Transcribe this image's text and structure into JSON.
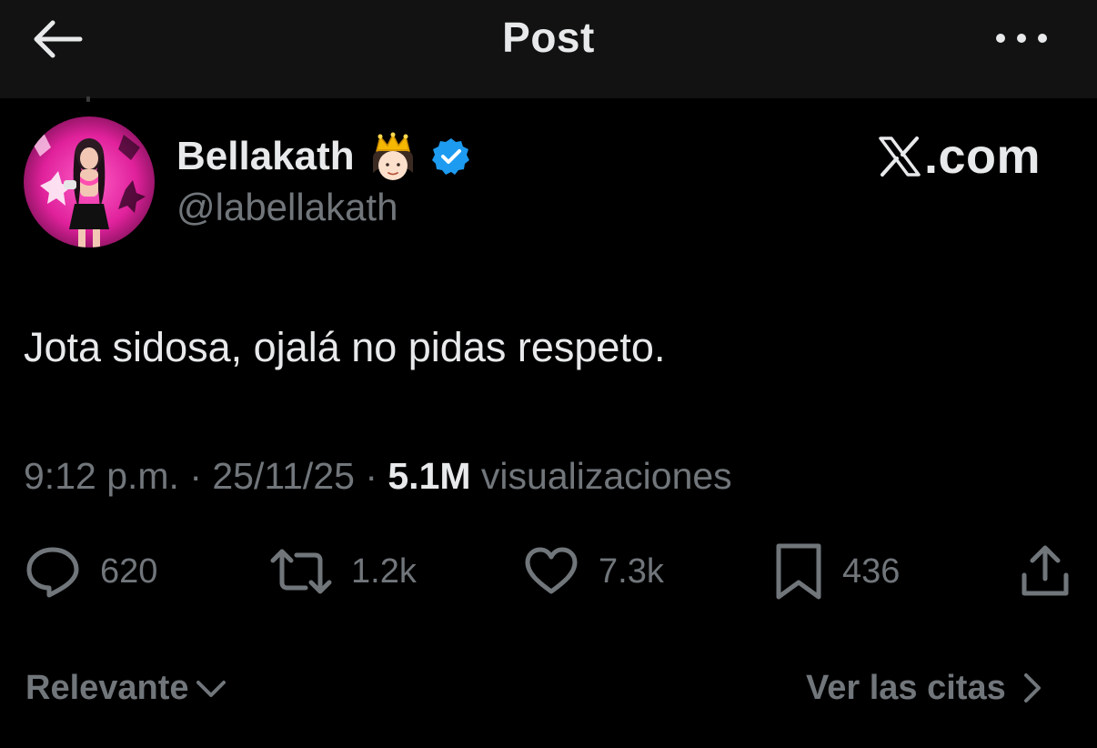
{
  "header": {
    "title": "Post",
    "back_icon": "arrow-left-icon",
    "more_icon": "more-horizontal-icon"
  },
  "author": {
    "display_name": "Bellakath",
    "name_emoji": "princess-emoji",
    "verified_icon": "verified-badge-icon",
    "verified_color": "#1d9bf0",
    "handle": "@labellakath"
  },
  "brand": {
    "text": ".com",
    "icon": "x-logo-icon"
  },
  "post": {
    "text": "Jota sidosa, ojalá no pidas respeto.",
    "time": "9:12 p.m.",
    "sep1": " · ",
    "date": "25/11/25",
    "sep2": " · ",
    "views_count": "5.1M",
    "views_label": " visualizaciones"
  },
  "actions": {
    "replies": "620",
    "reposts": "1.2k",
    "likes": "7.3k",
    "bookmarks": "436"
  },
  "footer": {
    "sort_label": "Relevante",
    "quotes_label": "Ver las citas"
  },
  "colors": {
    "background": "#000000",
    "topbar": "#121212",
    "primary_text": "#e7e9ea",
    "secondary_text": "#71767b",
    "accent": "#1d9bf0",
    "avatar_pink": "#e0219b"
  }
}
